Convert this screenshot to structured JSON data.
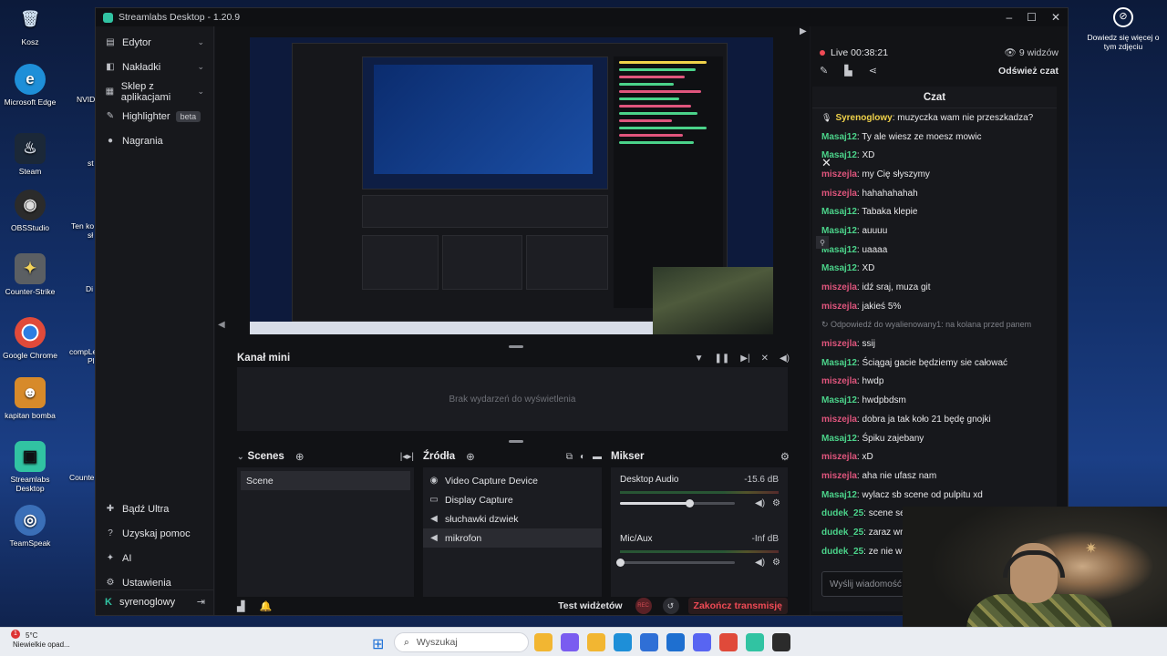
{
  "desktop": {
    "icons": [
      {
        "label": "Kosz",
        "icon": "trash-icon",
        "color": "#8fb3d9"
      },
      {
        "label": "Microsoft Edge",
        "icon": "edge-icon",
        "color": "#1e8fd8"
      },
      {
        "label": "Steam",
        "icon": "steam-icon",
        "color": "#1b2838"
      },
      {
        "label": "OBSStudio",
        "icon": "obs-icon",
        "color": "#2b2b2b"
      },
      {
        "label": "Counter-Strike",
        "icon": "counter-strike-icon",
        "color": "#5b5f63"
      },
      {
        "label": "Google Chrome",
        "icon": "chrome-icon",
        "color": "#e04a3a"
      },
      {
        "label": "kapitan bomba",
        "icon": "game-icon",
        "color": "#d78a2a"
      },
      {
        "label": "Streamlabs Desktop",
        "icon": "streamlabs-icon",
        "color": "#31c3a2"
      },
      {
        "label": "TeamSpeak",
        "icon": "teamspeak-icon",
        "color": "#3a6fb8"
      }
    ],
    "partial_labels": [
      "NVID",
      "st",
      "Ten ko",
      "sł",
      "Di",
      "compLe",
      "Pl",
      "Counte"
    ],
    "learn_more": "Dowiedz się więcej o tym zdjęciu"
  },
  "window": {
    "title": "Streamlabs Desktop - 1.20.9",
    "minimize": "–",
    "maximize": "☐",
    "close": "✕"
  },
  "sidebar": {
    "items": [
      {
        "label": "Edytor",
        "icon": "editor-icon"
      },
      {
        "label": "Nakładki",
        "icon": "overlays-icon"
      },
      {
        "label": "Sklep z aplikacjami",
        "icon": "app-store-icon"
      },
      {
        "label": "Highlighter",
        "icon": "highlighter-icon",
        "badge": "beta"
      },
      {
        "label": "Nagrania",
        "icon": "recordings-icon"
      }
    ],
    "bottom_items": [
      {
        "label": "Bądź Ultra",
        "icon": "ultra-icon"
      },
      {
        "label": "Uzyskaj pomoc",
        "icon": "help-icon"
      },
      {
        "label": "AI",
        "icon": "ai-icon"
      },
      {
        "label": "Ustawienia",
        "icon": "settings-icon"
      }
    ],
    "user": "syrenoglowy"
  },
  "mini_feed": {
    "title": "Kanał mini",
    "empty": "Brak wydarzeń do wyświetlenia"
  },
  "scenes": {
    "title": "Scenes",
    "items": [
      "Scene"
    ]
  },
  "sources": {
    "title": "Źródła",
    "items": [
      {
        "label": "Video Capture Device",
        "icon": "camera-icon"
      },
      {
        "label": "Display Capture",
        "icon": "monitor-icon"
      },
      {
        "label": "słuchawki dzwiek",
        "icon": "speaker-icon"
      },
      {
        "label": "mikrofon",
        "icon": "speaker-icon"
      }
    ],
    "selected": 3
  },
  "mixer": {
    "title": "Mikser",
    "channels": [
      {
        "name": "Desktop Audio",
        "db": "-15.6 dB",
        "level": 0.6
      },
      {
        "name": "Mic/Aux",
        "db": "-Inf dB",
        "level": 0.0
      }
    ]
  },
  "footer": {
    "test_widgets": "Test widżetów",
    "rec": "REC",
    "end_stream": "Zakończ transmisję"
  },
  "stream": {
    "live": "Live 00:38:21",
    "viewers": "9 widzów",
    "refresh_chat": "Odśwież czat"
  },
  "chat": {
    "title": "Czat",
    "messages": [
      {
        "user": "Syrenoglowy",
        "text": ": muzyczka wam nie przeszkadza?",
        "color": "#f0d24a",
        "badge": true
      },
      {
        "user": "Masaj12",
        "text": ": Ty ale wiesz ze moesz mowic",
        "color": "#4bd38a"
      },
      {
        "user": "Masaj12",
        "text": ": XD",
        "color": "#4bd38a"
      },
      {
        "user": "miszejla",
        "text": ": my Cię słyszymy",
        "color": "#e0557d"
      },
      {
        "user": "miszejla",
        "text": ": hahahahahah",
        "color": "#e0557d"
      },
      {
        "user": "Masaj12",
        "text": ": Tabaka klepie",
        "color": "#4bd38a"
      },
      {
        "user": "Masaj12",
        "text": ": auuuu",
        "color": "#4bd38a"
      },
      {
        "user": "Masaj12",
        "text": ": uaaaa",
        "color": "#4bd38a"
      },
      {
        "user": "Masaj12",
        "text": ": XD",
        "color": "#4bd38a"
      },
      {
        "user": "miszejla",
        "text": ": idź sraj, muza git",
        "color": "#e0557d"
      },
      {
        "user": "miszejla",
        "text": ": jakieś 5%",
        "color": "#e0557d"
      },
      {
        "user": "",
        "text": "↻ Odpowiedź do wyalienowany1: na kolana przed panem",
        "color": "#7e8087",
        "reply": true
      },
      {
        "user": "miszejla",
        "text": ": ssij",
        "color": "#e0557d"
      },
      {
        "user": "Masaj12",
        "text": ": Ściągaj gacie będziemy sie całować",
        "color": "#4bd38a"
      },
      {
        "user": "miszejla",
        "text": ": hwdp",
        "color": "#e0557d"
      },
      {
        "user": "Masaj12",
        "text": ": hwdpbdsm",
        "color": "#4bd38a"
      },
      {
        "user": "miszejla",
        "text": ": dobra ja tak koło 21 będę gnojki",
        "color": "#e0557d"
      },
      {
        "user": "Masaj12",
        "text": ": Śpiku zajebany",
        "color": "#4bd38a"
      },
      {
        "user": "miszejla",
        "text": ": xD",
        "color": "#e0557d"
      },
      {
        "user": "miszejla",
        "text": ": aha nie ufasz nam",
        "color": "#e0557d"
      },
      {
        "user": "Masaj12",
        "text": ": wylacz sb scene od pulpitu xd",
        "color": "#4bd38a"
      },
      {
        "user": "dudek_25",
        "text": ": scene se z",
        "color": "#4bd38a"
      },
      {
        "user": "dudek_25",
        "text": ": zaraz wra",
        "color": "#4bd38a"
      },
      {
        "user": "dudek_25",
        "text": ": ze nie wid",
        "color": "#4bd38a"
      }
    ],
    "input_placeholder": "Wyślij wiadomość"
  },
  "taskbar": {
    "weather_temp": "5°C",
    "weather_desc": "Niewielkie opad...",
    "notification_count": "1",
    "search": "Wyszukaj",
    "apps": [
      {
        "icon": "file-explorer-icon",
        "color": "#f2b632"
      },
      {
        "icon": "copilot-icon",
        "color": "#7a5cf0"
      },
      {
        "icon": "folder-icon",
        "color": "#f2b632"
      },
      {
        "icon": "edge-icon",
        "color": "#1e8fd8"
      },
      {
        "icon": "store-icon",
        "color": "#2f6fd6"
      },
      {
        "icon": "outlook-icon",
        "color": "#1e6fd0"
      },
      {
        "icon": "discord-icon",
        "color": "#5865f2"
      },
      {
        "icon": "chrome-icon",
        "color": "#e04a3a"
      },
      {
        "icon": "streamlabs-icon",
        "color": "#31c3a2"
      },
      {
        "icon": "obs-icon",
        "color": "#2b2b2b"
      }
    ]
  }
}
